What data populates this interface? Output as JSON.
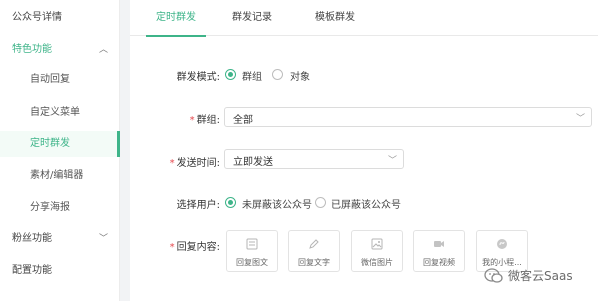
{
  "sidebar": {
    "items": [
      {
        "label": "公众号详情"
      },
      {
        "label": "特色功能"
      },
      {
        "label": "自动回复"
      },
      {
        "label": "自定义菜单"
      },
      {
        "label": "定时群发"
      },
      {
        "label": "素材/编辑器"
      },
      {
        "label": "分享海报"
      },
      {
        "label": "粉丝功能"
      },
      {
        "label": "配置功能"
      }
    ]
  },
  "tabs": [
    {
      "label": "定时群发"
    },
    {
      "label": "群发记录"
    },
    {
      "label": "模板群发"
    }
  ],
  "form": {
    "mode": {
      "label": "群发模式:",
      "options": [
        "群组",
        "对象"
      ],
      "selected": "群组"
    },
    "group": {
      "label": "群组:",
      "value": "全部"
    },
    "send_time": {
      "label": "发送时间:",
      "value": "立即发送"
    },
    "users": {
      "label": "选择用户:",
      "options": [
        "未屏蔽该公众号",
        "已屏蔽该公众号"
      ],
      "selected": "未屏蔽该公众号"
    },
    "reply": {
      "label": "回复内容:",
      "buttons": [
        {
          "label": "回复图文",
          "icon": "image-text-icon"
        },
        {
          "label": "回复文字",
          "icon": "pencil-icon"
        },
        {
          "label": "微信图片",
          "icon": "picture-icon"
        },
        {
          "label": "回复视频",
          "icon": "video-icon"
        },
        {
          "label": "我的小程...",
          "icon": "mini-program-icon"
        }
      ]
    }
  },
  "watermark": {
    "text": "微客云Saas"
  },
  "colors": {
    "accent": "#3eb489",
    "required": "#e5484d"
  }
}
